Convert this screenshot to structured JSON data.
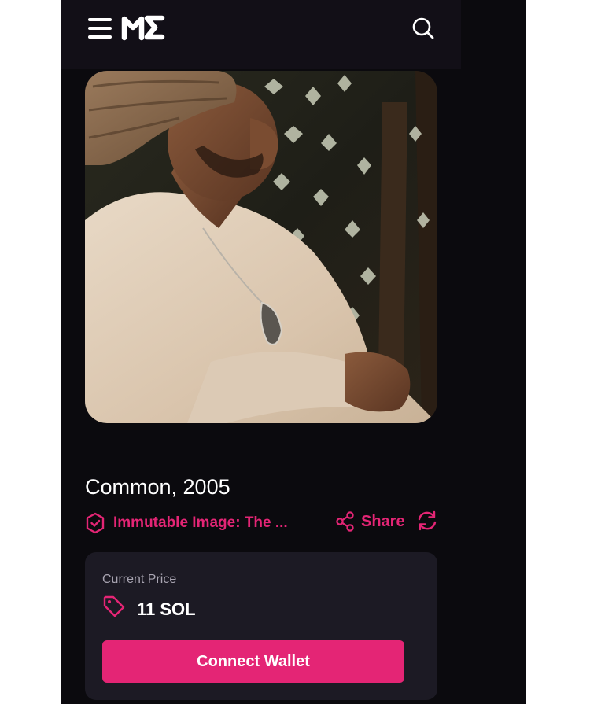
{
  "header": {
    "menu_icon": "hamburger-menu-icon",
    "logo_icon": "magic-eden-logo-icon",
    "search_icon": "search-icon"
  },
  "nft": {
    "title": "Common, 2005",
    "collection_label": "Immutable Image: The ...",
    "collection_icon": "verified-shield-icon",
    "share_label": "Share",
    "share_icon": "share-icon",
    "refresh_icon": "refresh-icon"
  },
  "price": {
    "caption": "Current Price",
    "value": "11 SOL",
    "tag_icon": "price-tag-icon",
    "button_label": "Connect Wallet"
  },
  "colors": {
    "accent": "#e42575",
    "background": "#0b0a0e",
    "header_bg": "#120f17",
    "card_bg": "#1c1a24"
  }
}
